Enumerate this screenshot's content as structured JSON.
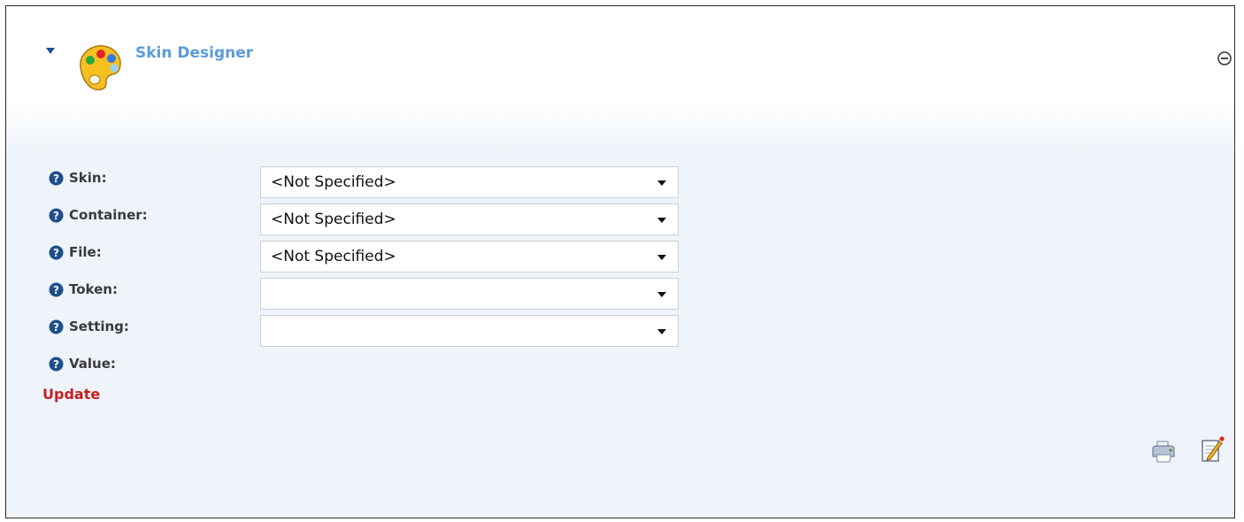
{
  "module": {
    "title": "Skin Designer",
    "icons": {
      "collapse": "triangle-down-icon",
      "title_icon": "palette-icon",
      "minimize": "minus-circle-icon"
    }
  },
  "form": {
    "rows": [
      {
        "label": "Skin:",
        "value": "<Not Specified>"
      },
      {
        "label": "Container:",
        "value": "<Not Specified>"
      },
      {
        "label": "File:",
        "value": "<Not Specified>"
      },
      {
        "label": "Token:",
        "value": ""
      },
      {
        "label": "Setting:",
        "value": ""
      },
      {
        "label": "Value:"
      }
    ],
    "update_label": "Update"
  },
  "footer": {
    "icons": [
      "print-icon",
      "edit-icon"
    ]
  },
  "colors": {
    "title": "#5b9bd9",
    "update": "#c81e1e",
    "help_icon": "#1f4e8c",
    "border": "#2b2b2b"
  }
}
